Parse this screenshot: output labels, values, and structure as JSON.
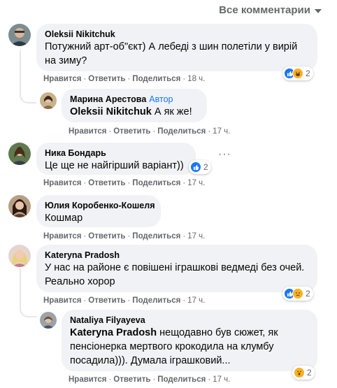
{
  "filter": {
    "label": "Все комментарии"
  },
  "actions": {
    "like": "Нравится",
    "reply": "Ответить",
    "share": "Поделиться"
  },
  "comments": [
    {
      "author": "Oleksii Nikitchuk",
      "text": "Потужний арт-об\"єкт) А лебеді з шин полетіли у вирій на зиму?",
      "time": "18 ч.",
      "reactions": {
        "icons": [
          "like-icon",
          "haha-icon"
        ],
        "count": "2"
      }
    },
    {
      "author": "Марина Арестова",
      "badge": "Автор",
      "mention": "Oleksii Nikitchuk",
      "text": " А як же!",
      "time": "17 ч."
    },
    {
      "author": "Ника Бондарь",
      "text": "Це ще не найгірший варіант))",
      "time": "17 ч.",
      "reactions": {
        "icons": [
          "like-icon"
        ],
        "count": "2"
      }
    },
    {
      "author": "Юлия Коробенко-Кошеля",
      "text": "Кошмар",
      "time": "17 ч."
    },
    {
      "author": "Kateryna Pradosh",
      "text": "У нас на районе є повішені іграшкові ведмеді без очей. Реально хорор",
      "time": "17 ч.",
      "reactions": {
        "icons": [
          "like-icon",
          "sad-icon"
        ],
        "count": "2"
      }
    },
    {
      "author": "Nataliya Filyayeva",
      "mention": "Kateryna Pradosh",
      "text": " нещодавно був сюжет, як пенсіонерка мертвого крокодила на клумбу посадила))). Думала іграшковий...",
      "time": "17 ч.",
      "reactions": {
        "icons": [
          "wow-icon"
        ],
        "count": "2"
      }
    }
  ]
}
